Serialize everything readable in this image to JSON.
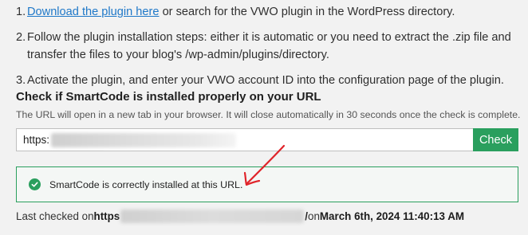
{
  "steps": [
    {
      "num": "1.",
      "link": "Download the plugin here",
      "text": " or search for the VWO plugin in the WordPress directory."
    },
    {
      "num": "2.",
      "text": "Follow the plugin installation steps: either it is automatic or you need to extract the .zip file and transfer the files to your blog's /wp-admin/plugins/directory."
    },
    {
      "num": "3.",
      "text": "Activate the plugin, and enter your VWO account ID into the configuration page of the plugin."
    }
  ],
  "checker": {
    "title": "Check if SmartCode is installed properly on your URL",
    "description": "The URL will open in a new tab in your browser. It will close automatically in 30 seconds once the check is complete.",
    "url_value": "https:",
    "button_label": "Check"
  },
  "status": {
    "message": "SmartCode is correctly installed at this URL.",
    "icon": "check-circle-icon",
    "color": "#2a9f5e"
  },
  "last_checked": {
    "prefix": "Last checked on ",
    "url_start": "https",
    "url_end": "/",
    "on_text": " on ",
    "date": "March 6th, 2024 11:40:13 AM"
  },
  "annotation": {
    "icon": "red-arrow-icon",
    "color": "#e0242a"
  }
}
